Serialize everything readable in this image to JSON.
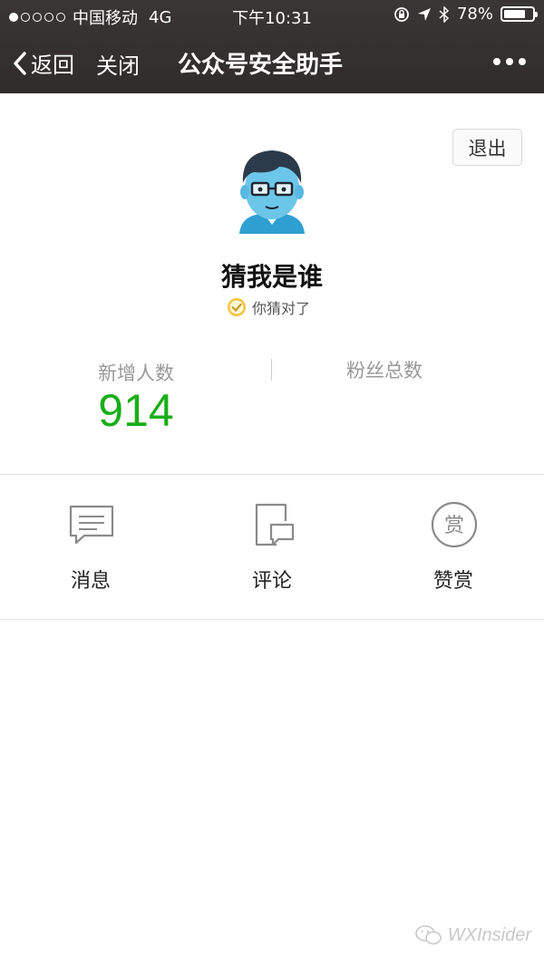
{
  "status_bar": {
    "carrier": "中国移动",
    "network": "4G",
    "time": "下午10:31",
    "battery": "78%",
    "battery_level": 0.78
  },
  "nav": {
    "back_label": "返回",
    "close_label": "关闭",
    "title": "公众号安全助手"
  },
  "profile": {
    "logout_label": "退出",
    "name": "猜我是谁",
    "verified_text": "你猜对了"
  },
  "stats": {
    "new_followers_label": "新增人数",
    "new_followers_value": "914",
    "total_followers_label": "粉丝总数"
  },
  "actions": [
    {
      "label": "消息",
      "icon": "message-icon"
    },
    {
      "label": "评论",
      "icon": "comment-icon"
    },
    {
      "label": "赞赏",
      "icon": "reward-icon",
      "icon_char": "赏"
    }
  ],
  "watermark": "WXInsider",
  "colors": {
    "accent_green": "#1aad19",
    "topbar": "#2f2c2c"
  }
}
